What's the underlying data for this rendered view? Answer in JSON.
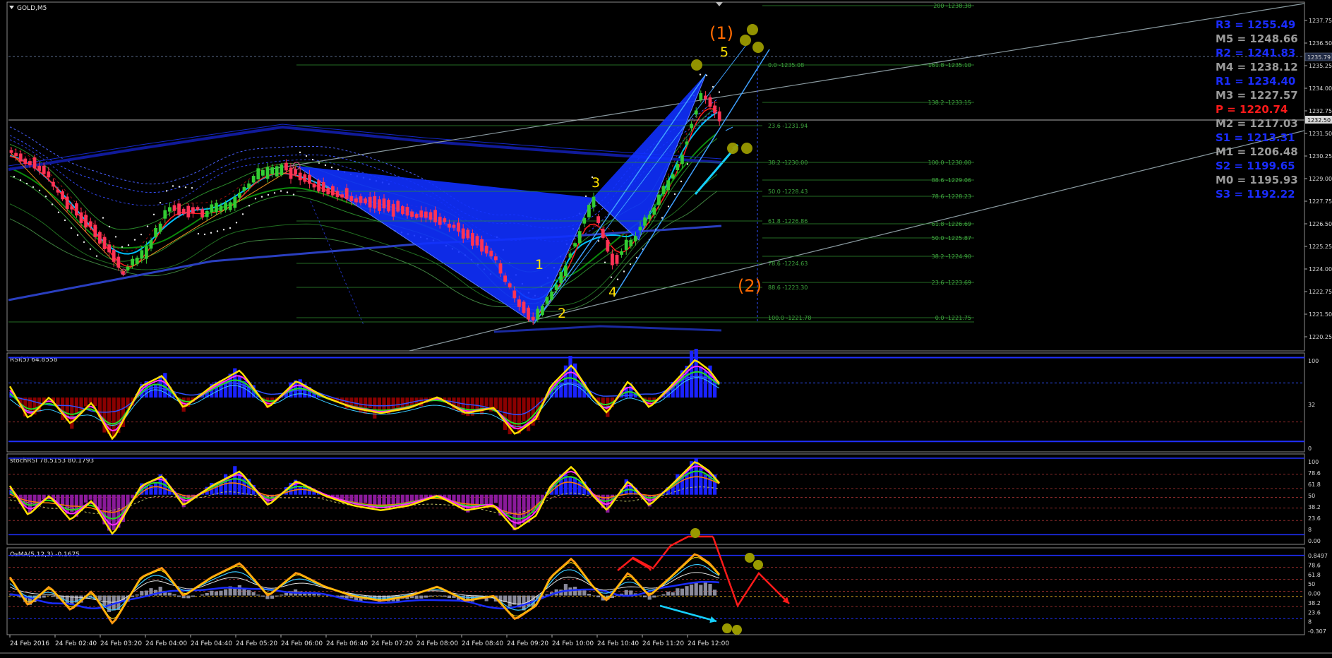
{
  "window": {
    "title": "GOLD,M5"
  },
  "colors": {
    "background": "#000000",
    "bull_candle": "#33cc33",
    "bear_candle": "#ff3355",
    "pattern_fill": "#1030ff",
    "grid_level": "#2f8f2f",
    "pivot_blue": "#1a2cff",
    "pivot_gray": "#9a9a9a",
    "pivot_red": "#ff1a1a",
    "wave_yellow": "#ffe000",
    "wave_orange": "#ff6a00",
    "rsi_line": "#ffe000",
    "hist_blue": "#1a22ff",
    "hist_red": "#8a0000",
    "hist_purple": "#8a1a9a"
  },
  "pivots": [
    {
      "label": "R3 = 1255.49",
      "color": "#1a2cff"
    },
    {
      "label": "M5 = 1248.66",
      "color": "#9a9a9a"
    },
    {
      "label": "R2 = 1241.83",
      "color": "#1a2cff"
    },
    {
      "label": "M4 = 1238.12",
      "color": "#9a9a9a"
    },
    {
      "label": "R1 = 1234.40",
      "color": "#1a2cff"
    },
    {
      "label": "M3 = 1227.57",
      "color": "#9a9a9a"
    },
    {
      "label": "P   = 1220.74",
      "color": "#ff1a1a"
    },
    {
      "label": "M2 = 1217.03",
      "color": "#9a9a9a"
    },
    {
      "label": "S1 = 1213.31",
      "color": "#1a2cff"
    },
    {
      "label": "M1 = 1206.48",
      "color": "#9a9a9a"
    },
    {
      "label": "S2 = 1199.65",
      "color": "#1a2cff"
    },
    {
      "label": "M0 = 1195.93",
      "color": "#9a9a9a"
    },
    {
      "label": "S3 = 1192.22",
      "color": "#1a2cff"
    }
  ],
  "price_axis": {
    "ticks": [
      "1237.75",
      "1236.50",
      "1235.25",
      "1234.00",
      "1232.75",
      "1231.50",
      "1230.25",
      "1229.00",
      "1227.75",
      "1226.50",
      "1225.25",
      "1224.00",
      "1222.75",
      "1221.50",
      "1220.25"
    ],
    "current_price_tag": "1232.50",
    "r2_tag": "1235.79"
  },
  "fib_labels_left": [
    "0.0 -1235.08",
    "23.6 -1231.94",
    "38.2 -1230.00",
    "50.0 -1228.43",
    "61.8 -1226.86",
    "78.6 -1224.63",
    "88.6 -1223.30",
    "100.0 -1221.78"
  ],
  "fib_labels_right": [
    "200 -1238.38",
    "161.8 -1235.10",
    "138.2 -1233.15",
    "100.0 -1230.00",
    "88.6 -1229.06",
    "78.6 -1228.23",
    "61.8 -1226.69",
    "50.0 -1225.87",
    "38.2 -1224.90",
    "23.6 -1223.69",
    "0.0 -1221.75"
  ],
  "wave_labels": {
    "w1": "1",
    "w2": "2",
    "w3": "3",
    "w4": "4",
    "w5": "5",
    "big1": "(1)",
    "big2": "(2)"
  },
  "time_axis": [
    "24 Feb 2016",
    "24 Feb 02:40",
    "24 Feb 03:20",
    "24 Feb 04:00",
    "24 Feb 04:40",
    "24 Feb 05:20",
    "24 Feb 06:00",
    "24 Feb 06:40",
    "24 Feb 07:20",
    "24 Feb 08:00",
    "24 Feb 08:40",
    "24 Feb 09:20",
    "24 Feb 10:00",
    "24 Feb 10:40",
    "24 Feb 11:20",
    "24 Feb 12:00"
  ],
  "panels": {
    "rsi": {
      "title": "RSI(5) 64.8558",
      "scale": [
        "100",
        "32",
        "0"
      ]
    },
    "stoch": {
      "title": "stochRSI 78.5153 80.1793",
      "scale": [
        "100",
        "78.6",
        "61.8",
        "50",
        "38.2",
        "23.6",
        "8",
        "0.00"
      ]
    },
    "osma": {
      "title": "OsMA(5,12,3) -0.1675",
      "scale": [
        "0.8497",
        "78.6",
        "61.8",
        "50",
        "0.00",
        "38.2",
        "23.6",
        "8",
        "-0.307"
      ]
    }
  }
}
